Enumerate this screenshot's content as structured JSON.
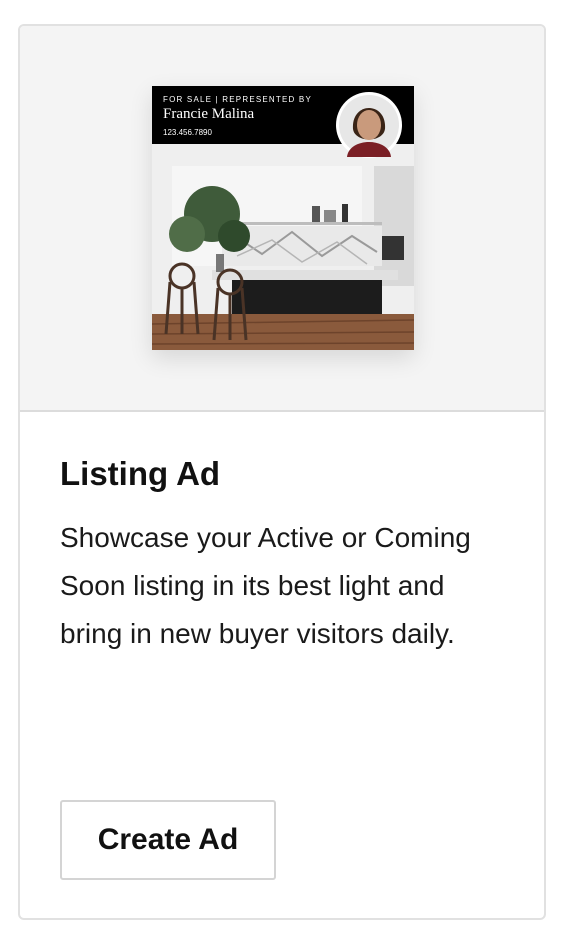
{
  "card": {
    "preview": {
      "kicker": "FOR SALE | REPRESENTED BY",
      "agent_name": "Francie Malina",
      "phone": "123.456.7890"
    },
    "title": "Listing Ad",
    "description": "Showcase your Active or Coming Soon listing in its best light and bring in new buyer visitors daily.",
    "button_label": "Create Ad"
  }
}
